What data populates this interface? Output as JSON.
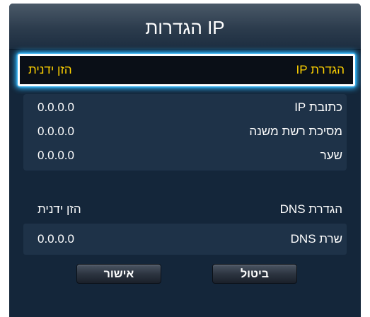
{
  "dialog": {
    "title": "הגדרות IP"
  },
  "ip_setting": {
    "label": "הגדרת IP",
    "value": "הזן ידנית"
  },
  "ip_fields": [
    {
      "label": "כתובת IP",
      "value": "0.0.0.0"
    },
    {
      "label": "מסיכת רשת משנה",
      "value": "0.0.0.0"
    },
    {
      "label": "שער",
      "value": "0.0.0.0"
    }
  ],
  "dns_setting": {
    "label": "הגדרת DNS",
    "value": "הזן ידנית"
  },
  "dns_server": {
    "label": "שרת DNS",
    "value": "0.0.0.0"
  },
  "buttons": {
    "ok_label": "אישור",
    "cancel_label": "ביטול"
  },
  "colors": {
    "focus_text": "#ffd200",
    "focus_glow": "#2bb7ff",
    "dialog_bg": "#14263a"
  }
}
